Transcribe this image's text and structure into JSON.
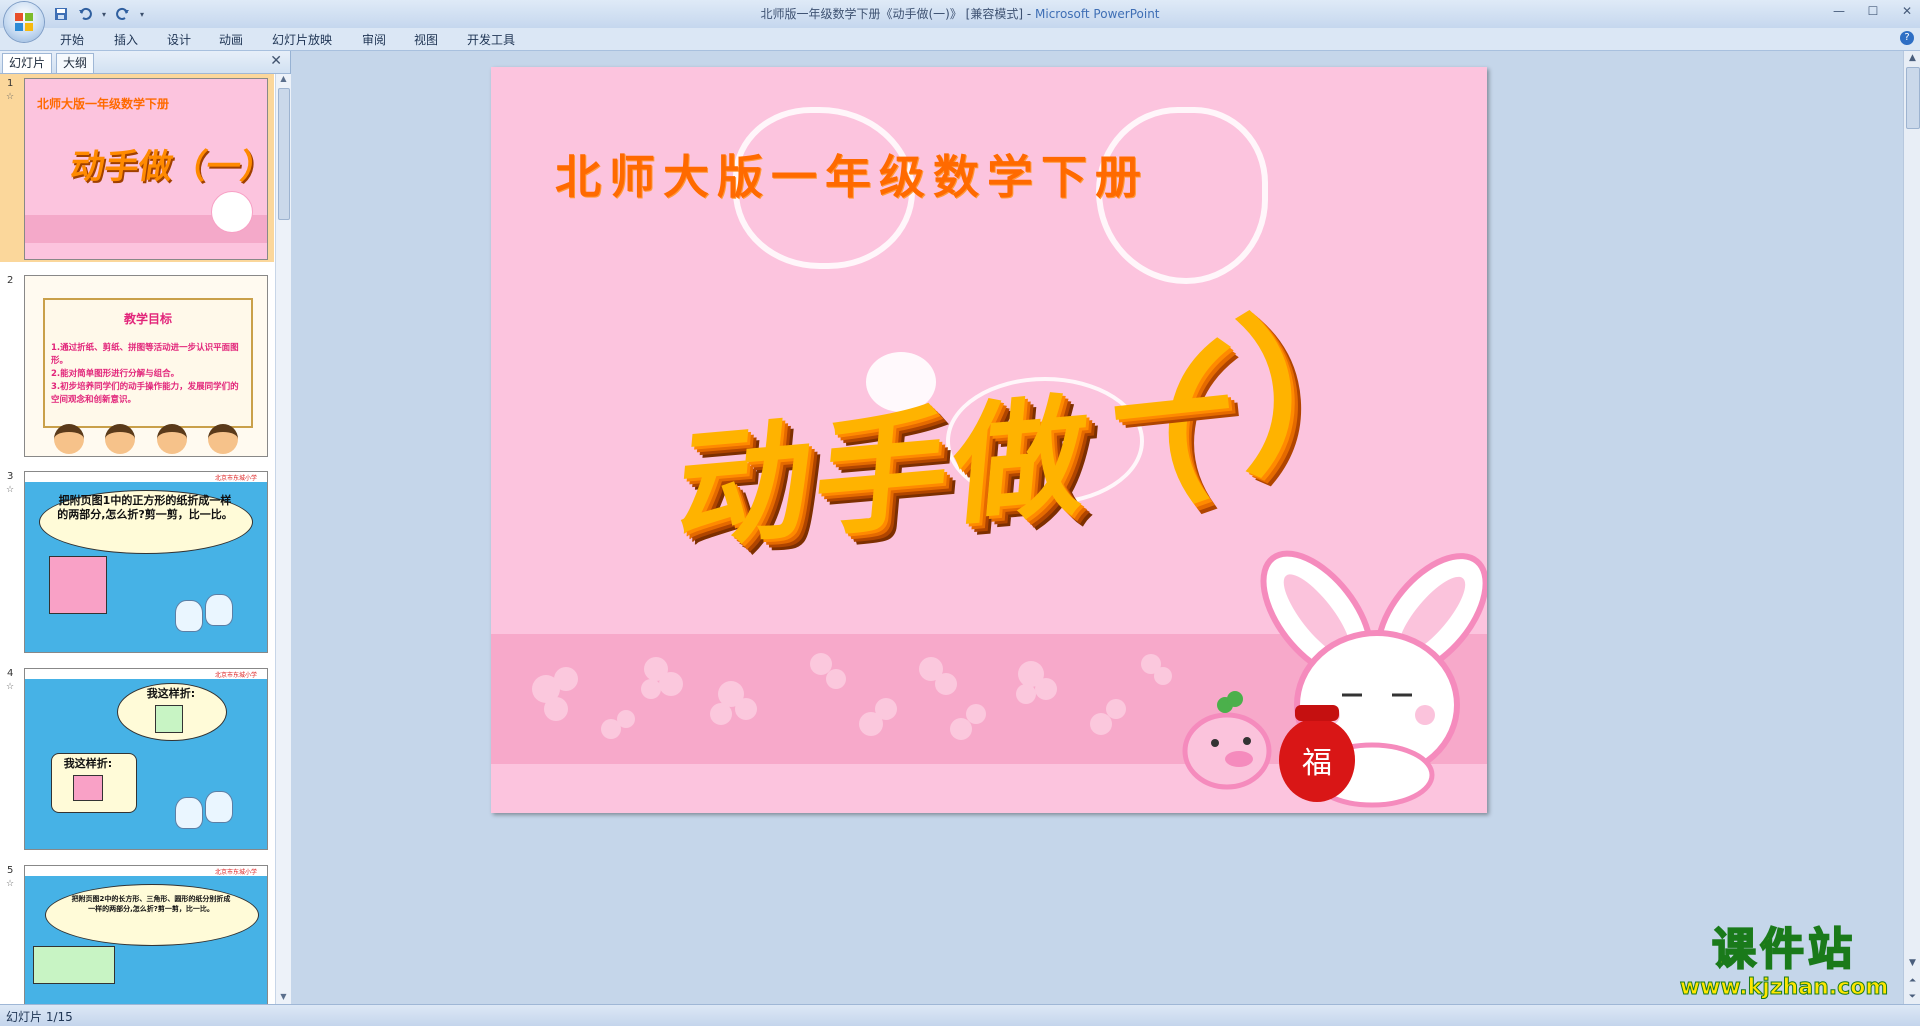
{
  "window": {
    "title_prefix": "北师版一年级数学下册《动手做(一)》 [兼容模式]",
    "title_sep": " - ",
    "app_name": "Microsoft PowerPoint"
  },
  "ribbon_tabs": [
    "开始",
    "插入",
    "设计",
    "动画",
    "幻灯片放映",
    "审阅",
    "视图",
    "开发工具"
  ],
  "pane": {
    "tabs": [
      "幻灯片",
      "大纲"
    ],
    "close": "✕"
  },
  "thumbnails": {
    "slide1": {
      "num": "1",
      "title": "北师大版一年级数学下册",
      "big": "动手做（一）"
    },
    "slide2": {
      "num": "2",
      "heading": "教学目标",
      "lines": [
        "1.通过折纸、剪纸、拼图等活动进一步认识平面图形。",
        "2.能对简单图形进行分解与组合。",
        "3.初步培养同学们的动手操作能力，发展同学们的空间观念和创新意识。"
      ]
    },
    "slide3": {
      "num": "3",
      "header": "北京市东城小学",
      "cloud": "把附页图1中的正方形的纸折成一样的两部分,怎么折?剪一剪，比一比。"
    },
    "slide4": {
      "num": "4",
      "header": "北京市东城小学",
      "cloud_a": "我这样折:",
      "cloud_b": "我这样折:"
    },
    "slide5": {
      "num": "5",
      "header": "北京市东城小学",
      "cloud": "把附页图2中的长方形、三角形、圆形的纸分别折成一样的两部分,怎么折?剪一剪，比一比。"
    }
  },
  "slide": {
    "title": "北师大版一年级数学下册",
    "big_text": "动手做",
    "paren_open": "（",
    "dash": "一",
    "paren_close": "）"
  },
  "watermark": {
    "name": "课件站",
    "url": "www.kjzhan.com"
  },
  "status": {
    "slide_info": "幻灯片 1/15"
  },
  "colors": {
    "slide_bg": "#fcc4de",
    "title_orange": "#ff6a00",
    "band_pink": "#f7a9ca"
  }
}
